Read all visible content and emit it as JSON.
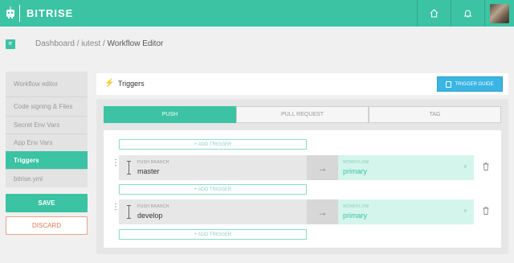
{
  "topbar": {
    "brand": "BITRISE",
    "icons": {
      "logo": "bitrise-robot-icon",
      "home": "home-icon",
      "bell": "bell-icon"
    },
    "accent": "#3bc3a3"
  },
  "breadcrumb": {
    "badge": "IT",
    "dashboard": "Dashboard",
    "separator": "/",
    "app": "iutest",
    "current": "Workflow Editor"
  },
  "sidebar": {
    "items": [
      {
        "label": "Workflow editor"
      },
      {
        "label": "Code signing & Files"
      },
      {
        "label": "Secret Env Vars"
      },
      {
        "label": "App Env Vars"
      },
      {
        "label": "Triggers"
      },
      {
        "label": "bitrise.yml"
      }
    ],
    "save_label": "SAVE",
    "discard_label": "DISCARD"
  },
  "main": {
    "title": "Triggers",
    "guide_label": "TRIGGER GUIDE",
    "tabs": [
      {
        "label": "PUSH"
      },
      {
        "label": "PULL REQUEST"
      },
      {
        "label": "TAG"
      }
    ],
    "add_trigger_label": "+ ADD TRIGGER",
    "triggers": [
      {
        "branch_label": "PUSH BRANCH",
        "branch": "master",
        "workflow_label": "WORKFLOW",
        "workflow": "primary"
      },
      {
        "branch_label": "PUSH BRANCH",
        "branch": "develop",
        "workflow_label": "WORKFLOW",
        "workflow": "primary"
      }
    ]
  }
}
